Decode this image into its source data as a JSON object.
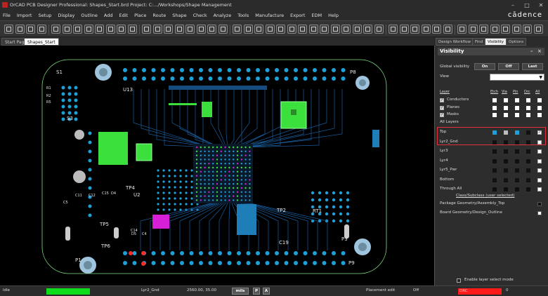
{
  "window": {
    "title": "OrCAD PCB Designer Professional: Shapes_Start.brd  Project: C:.../Workshops/Shape Management",
    "minimize": "–",
    "maximize": "□",
    "close": "✕"
  },
  "menu": [
    "File",
    "Import",
    "Setup",
    "Display",
    "Outline",
    "Add",
    "Edit",
    "Place",
    "Route",
    "Shape",
    "Check",
    "Analyze",
    "Tools",
    "Manufacture",
    "Export",
    "EDM",
    "Help"
  ],
  "brand": "cādence",
  "toolbar": {
    "tool_count": 48
  },
  "tabs": [
    {
      "label": "Start Page",
      "active": false
    },
    {
      "label": "Shapes_Start",
      "active": true
    }
  ],
  "right_tabs": [
    {
      "label": "Design Workflow",
      "active": false
    },
    {
      "label": "Find",
      "active": false
    },
    {
      "label": "Visibility",
      "active": true
    },
    {
      "label": "Options",
      "active": false
    }
  ],
  "visibility": {
    "header": "Visibility",
    "global_label": "Global visibility",
    "on_label": "On",
    "off_label": "Off",
    "last_label": "Last",
    "view_label": "View",
    "view_value": "",
    "layer_hdr": "Layer",
    "col_headers": [
      "Etch",
      "Via",
      "Pin",
      "Drc",
      "All"
    ],
    "categories": [
      {
        "label": "Conductors",
        "checked": true
      },
      {
        "label": "Planes",
        "checked": true
      },
      {
        "label": "Masks",
        "checked": true
      },
      {
        "label": "All Layers",
        "checked": false
      }
    ],
    "layers": [
      {
        "label": "Top",
        "colors": [
          "#1ea0d8",
          "#bdbdbd",
          "#1ea0d8",
          "#111111"
        ],
        "all": "✓"
      },
      {
        "label": "Lyr2_Gnd",
        "colors": [
          "#111111",
          "#111111",
          "#111111",
          "#111111"
        ],
        "all": ""
      },
      {
        "label": "Lyr3",
        "colors": [
          "#111111",
          "#111111",
          "#111111",
          "#111111"
        ],
        "all": ""
      },
      {
        "label": "Lyr4",
        "colors": [
          "#111111",
          "#111111",
          "#111111",
          "#111111"
        ],
        "all": ""
      },
      {
        "label": "Lyr5_Pwr",
        "colors": [
          "#111111",
          "#111111",
          "#111111",
          "#111111"
        ],
        "all": ""
      },
      {
        "label": "Bottom",
        "colors": [
          "#111111",
          "#111111",
          "#111111",
          "#111111"
        ],
        "all": ""
      },
      {
        "label": "Through All",
        "colors": [
          "#111111",
          "#111111",
          "#111111",
          "#111111"
        ],
        "all": ""
      }
    ],
    "subclass_link": "Class/Subclass (user selected)",
    "subclasses": [
      {
        "label": "Package Geometry/Assembly_Top",
        "color": "#111111"
      },
      {
        "label": "Board Geometry/Design_Outline",
        "color": "#ffffff"
      }
    ],
    "layer_select_mode": "Enable layer select mode"
  },
  "board": {
    "labels": [
      "S1",
      "P8",
      "U13",
      "S3",
      "P1",
      "P3",
      "P9",
      "RT1",
      "U2",
      "TP4",
      "TP5",
      "TP6",
      "TP2",
      "C19",
      "R1",
      "R2",
      "R5",
      "C11",
      "C12",
      "C14",
      "C15",
      "D4",
      "D5",
      "C4",
      "C5"
    ]
  },
  "status": {
    "state": "Idle",
    "layer": "Lyr2_Gnd",
    "coords": "2560.00, 35.00",
    "units": "mils",
    "p_btn": "P",
    "a_btn": "A",
    "mode": "Placement edit",
    "off": "Off",
    "drc_label": "DRC",
    "drc_count": "0"
  }
}
